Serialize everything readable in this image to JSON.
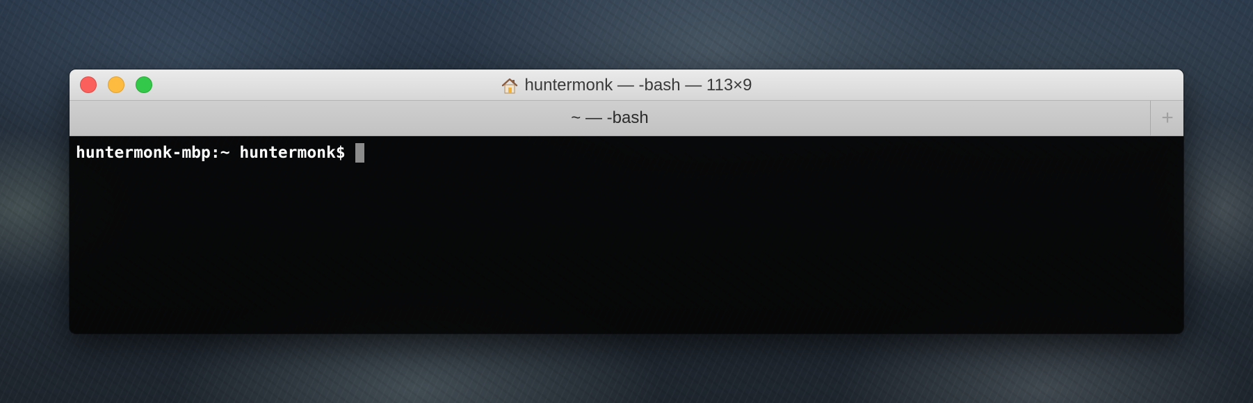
{
  "window": {
    "title": "huntermonk — -bash — 113×9",
    "title_icon": "home-icon"
  },
  "tabs": [
    {
      "label": "~ — -bash"
    }
  ],
  "tabbar": {
    "new_tab_label": "+"
  },
  "terminal": {
    "prompt": "huntermonk-mbp:~ huntermonk$"
  },
  "colors": {
    "close": "#fc605c",
    "minimize": "#fdbc40",
    "maximize": "#34c84a",
    "terminal_bg": "#050505",
    "terminal_fg": "#ffffff",
    "cursor": "#8c8c8c"
  }
}
